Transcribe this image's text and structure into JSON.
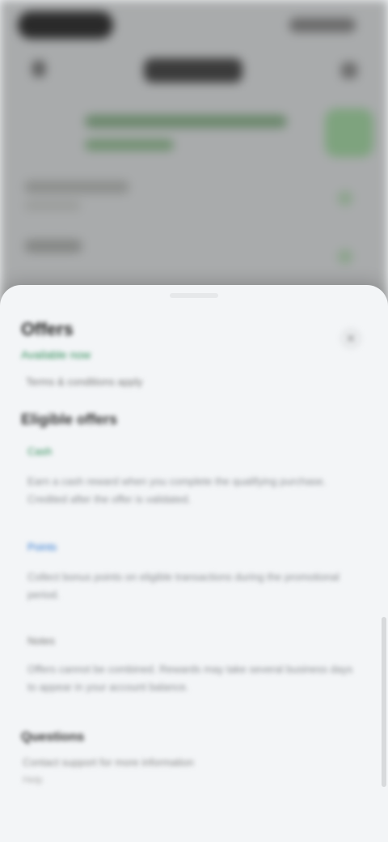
{
  "sheet": {
    "title": "Offers",
    "subtitle": "Available now",
    "close_glyph": "×",
    "note": "Terms & conditions apply",
    "section_title": "Eligible offers",
    "paragraphs": [
      {
        "label": "Cash",
        "label_color": "#2e8b57",
        "text": "Earn a cash reward when you complete the qualifying purchase. Credited after the offer is validated."
      },
      {
        "label": "Points",
        "label_color": "#2f78d1",
        "text": "Collect bonus points on eligible transactions during the promotional period."
      },
      {
        "label": "Notes",
        "label_color": "#777777",
        "text": "Offers cannot be combined. Rewards may take several business days to appear in your account balance."
      }
    ],
    "footer_title": "Questions",
    "footer_line": "Contact support for more information",
    "footer_line2": "Help"
  }
}
